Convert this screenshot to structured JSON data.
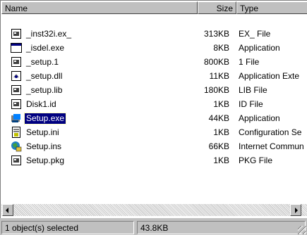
{
  "columns": {
    "name": "Name",
    "size": "Size",
    "type": "Type"
  },
  "files": [
    {
      "name": "_inst32i.ex_",
      "size": "313KB",
      "type": "EX_ File",
      "icon": "document-icon"
    },
    {
      "name": "_isdel.exe",
      "size": "8KB",
      "type": "Application",
      "icon": "window-app-icon"
    },
    {
      "name": "_setup.1",
      "size": "800KB",
      "type": "1 File",
      "icon": "document-icon"
    },
    {
      "name": "_setup.dll",
      "size": "11KB",
      "type": "Application Exte",
      "icon": "dll-icon"
    },
    {
      "name": "_setup.lib",
      "size": "180KB",
      "type": "LIB File",
      "icon": "document-icon"
    },
    {
      "name": "Disk1.id",
      "size": "1KB",
      "type": "ID File",
      "icon": "document-icon"
    },
    {
      "name": "Setup.exe",
      "size": "44KB",
      "type": "Application",
      "icon": "setup-app-icon",
      "selected": true
    },
    {
      "name": "Setup.ini",
      "size": "1KB",
      "type": "Configuration Se",
      "icon": "config-file-icon"
    },
    {
      "name": "Setup.ins",
      "size": "66KB",
      "type": "Internet Commun",
      "icon": "internet-file-icon"
    },
    {
      "name": "Setup.pkg",
      "size": "1KB",
      "type": "PKG File",
      "icon": "document-icon"
    }
  ],
  "status": {
    "selection": "1 object(s) selected",
    "size": "43.8KB"
  }
}
